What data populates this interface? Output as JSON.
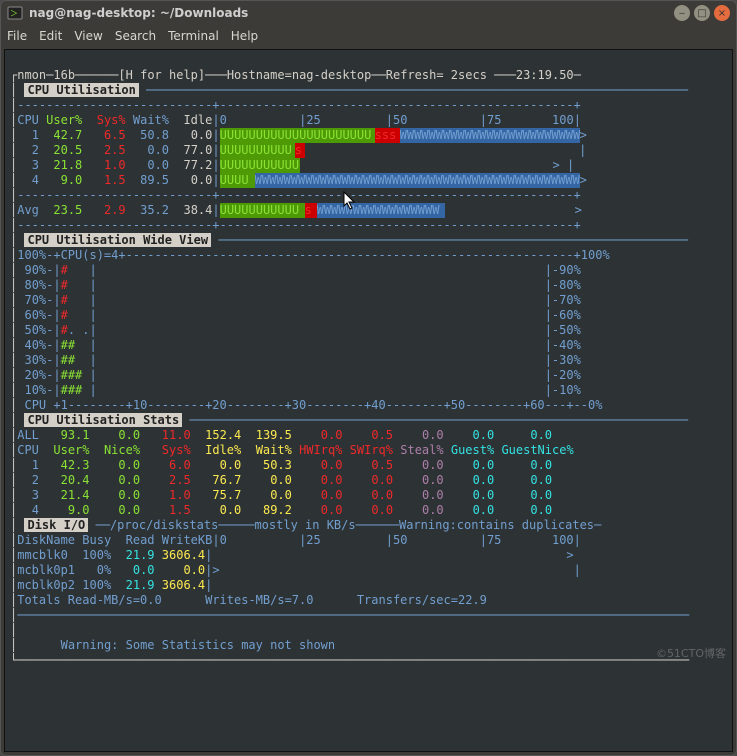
{
  "window": {
    "title": "nag@nag-desktop: ~/Downloads"
  },
  "menu": [
    "File",
    "Edit",
    "View",
    "Search",
    "Terminal",
    "Help"
  ],
  "header": {
    "prog": "nmon",
    "ver": "16b",
    "help": "[H for help]",
    "hostlabel": "Hostname=",
    "host": "nag-desktop",
    "refresh": "Refresh= 2secs",
    "time": "23:19.50"
  },
  "sections": {
    "cpu_util": "CPU Utilisation",
    "cpu_wide": "CPU Utilisation Wide View",
    "cpu_stats": "CPU Utilisation Stats",
    "disk_io": "Disk I/O"
  },
  "cpu_util": {
    "cols": {
      "cpu": "CPU",
      "user": "User%",
      "sys": "Sys%",
      "wait": "Wait%",
      "idle": "Idle"
    },
    "scale": [
      "0",
      "25",
      "50",
      "75",
      "100"
    ],
    "rows": [
      {
        "id": "1",
        "user": "42.7",
        "sys": "6.5",
        "wait": "50.8",
        "idle": "0.0"
      },
      {
        "id": "2",
        "user": "20.5",
        "sys": "2.5",
        "wait": "0.0",
        "idle": "77.0"
      },
      {
        "id": "3",
        "user": "21.8",
        "sys": "1.0",
        "wait": "0.0",
        "idle": "77.2"
      },
      {
        "id": "4",
        "user": "9.0",
        "sys": "1.5",
        "wait": "89.5",
        "idle": "0.0"
      }
    ],
    "avg": {
      "label": "Avg",
      "user": "23.5",
      "sys": "2.9",
      "wait": "35.2",
      "idle": "38.4"
    }
  },
  "cpu_wide": {
    "top_left": "100%-+CPU(s)=4+",
    "top_right": "+100%",
    "ladder": [
      {
        "pct": "90",
        "marks": "#"
      },
      {
        "pct": "80",
        "marks": "#"
      },
      {
        "pct": "70",
        "marks": "#"
      },
      {
        "pct": "60",
        "marks": "#"
      },
      {
        "pct": "50",
        "marks": "#. ."
      },
      {
        "pct": "40",
        "marks": "##"
      },
      {
        "pct": "30",
        "marks": "##"
      },
      {
        "pct": "20",
        "marks": "###"
      },
      {
        "pct": "10",
        "marks": "###"
      }
    ],
    "axis": "CPU +1--------+10--------+20--------+30--------+40--------+50--------+60---+--0%"
  },
  "cpu_stats": {
    "all_label": "ALL",
    "all": [
      "93.1",
      "0.0",
      "11.0",
      "152.4",
      "139.5",
      "0.0",
      "0.5",
      "0.0",
      "0.0",
      "0.0"
    ],
    "cols": [
      "CPU",
      "User%",
      "Nice%",
      "Sys%",
      "Idle%",
      "Wait%",
      "HWIrq%",
      "SWIrq%",
      "Steal%",
      "Guest%",
      "GuestNice%"
    ],
    "rows": [
      {
        "id": "1",
        "vals": [
          "42.3",
          "0.0",
          "6.0",
          "0.0",
          "50.3",
          "0.0",
          "0.5",
          "0.0",
          "0.0",
          "0.0"
        ]
      },
      {
        "id": "2",
        "vals": [
          "20.4",
          "0.0",
          "2.5",
          "76.7",
          "0.0",
          "0.0",
          "0.0",
          "0.0",
          "0.0",
          "0.0"
        ]
      },
      {
        "id": "3",
        "vals": [
          "21.4",
          "0.0",
          "1.0",
          "75.7",
          "0.0",
          "0.0",
          "0.0",
          "0.0",
          "0.0",
          "0.0"
        ]
      },
      {
        "id": "4",
        "vals": [
          "9.0",
          "0.0",
          "1.5",
          "0.0",
          "89.2",
          "0.0",
          "0.0",
          "0.0",
          "0.0",
          "0.0"
        ]
      }
    ]
  },
  "disk": {
    "src": "/proc/diskstats",
    "note1": "mostly in KB/s",
    "note2": "Warning:contains duplicates",
    "cols": {
      "name": "DiskName",
      "busy": "Busy",
      "read": "Read",
      "write": "Write",
      "kb": "KB"
    },
    "scale": [
      "0",
      "25",
      "50",
      "75",
      "100"
    ],
    "rows": [
      {
        "name": "mmcblk0",
        "busy": "100%",
        "read": "21.9",
        "write": "3606.4",
        "bar": ">"
      },
      {
        "name": "mcblk0p1",
        "busy": "0%",
        "read": "0.0",
        "write": "0.0",
        "bar": ">"
      },
      {
        "name": "mcblk0p2",
        "busy": "100%",
        "read": "21.9",
        "write": "3606.4",
        "bar": ""
      }
    ],
    "totals": {
      "read": "Totals Read-MB/s=0.0",
      "write": "Writes-MB/s=7.0",
      "xfer": "Transfers/sec=22.9"
    }
  },
  "footer": "Warning: Some Statistics may not shown",
  "watermark": "©51CTO博客"
}
